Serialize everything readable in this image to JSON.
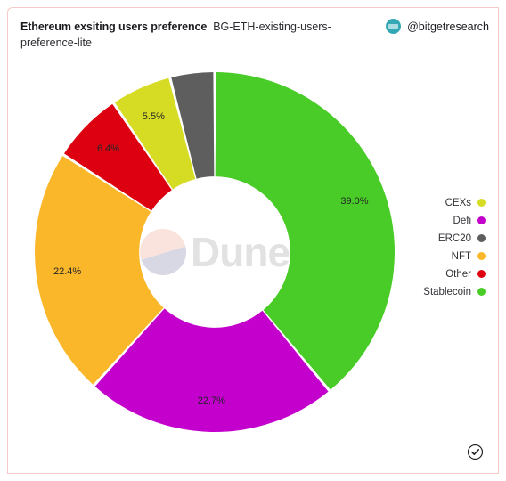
{
  "header": {
    "title": "Ethereum exsiting users preference",
    "subtitle": "BG-ETH-existing-users-preference-lite",
    "handle": "@bitgetresearch",
    "avatar_icon": "bitget-avatar-icon"
  },
  "watermark": {
    "text": "Dune",
    "logo_icon": "dune-logo-icon"
  },
  "footer": {
    "verified_icon": "check-circle-icon"
  },
  "colors": {
    "card_border": "#f6c9c9",
    "background": "#ffffff",
    "stablecoin": "#4acc28",
    "defi": "#c400cc",
    "nft": "#fbb72a",
    "other": "#dc0011",
    "cexs": "#d6dc24",
    "erc20": "#5e5e5e"
  },
  "chart_data": {
    "type": "pie",
    "title": "Ethereum exsiting users preference",
    "subtitle": "BG-ETH-existing-users-preference-lite",
    "variant": "donut",
    "start_angle_deg": 0,
    "direction": "clockwise",
    "inner_radius_ratio": 0.42,
    "legend_position": "right",
    "categories": [
      "Stablecoin",
      "Defi",
      "NFT",
      "Other",
      "CEXs",
      "ERC20"
    ],
    "values": [
      39.0,
      22.7,
      22.4,
      6.4,
      5.5,
      4.0
    ],
    "value_unit": "%",
    "slices": [
      {
        "name": "Stablecoin",
        "value": 39.0,
        "label": "39.0%",
        "color": "#4acc28",
        "label_visible": true
      },
      {
        "name": "Defi",
        "value": 22.7,
        "label": "22.7%",
        "color": "#c400cc",
        "label_visible": true
      },
      {
        "name": "NFT",
        "value": 22.4,
        "label": "22.4%",
        "color": "#fbb72a",
        "label_visible": true
      },
      {
        "name": "Other",
        "value": 6.4,
        "label": "6.4%",
        "color": "#dc0011",
        "label_visible": true
      },
      {
        "name": "CEXs",
        "value": 5.5,
        "label": "5.5%",
        "color": "#d6dc24",
        "label_visible": true
      },
      {
        "name": "ERC20",
        "value": 4.0,
        "label": "",
        "color": "#5e5e5e",
        "label_visible": false
      }
    ],
    "legend": [
      {
        "label": "CEXs",
        "color": "#d6dc24"
      },
      {
        "label": "Defi",
        "color": "#c400cc"
      },
      {
        "label": "ERC20",
        "color": "#5e5e5e"
      },
      {
        "label": "NFT",
        "color": "#fbb72a"
      },
      {
        "label": "Other",
        "color": "#dc0011"
      },
      {
        "label": "Stablecoin",
        "color": "#4acc28"
      }
    ]
  }
}
